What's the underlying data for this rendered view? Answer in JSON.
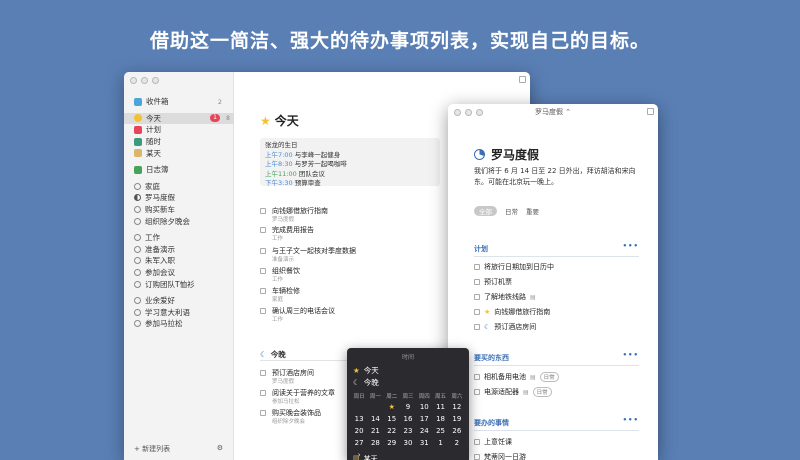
{
  "headline": "借助这一简洁、强大的待办事项列表，实现自己的目标。",
  "sidebar": {
    "items": [
      {
        "label": "收件箱",
        "count": "2",
        "color": "#4aa6d8"
      },
      {
        "label": "今天",
        "badge": "1",
        "count": "8",
        "color": "#f3c233"
      },
      {
        "label": "计划",
        "color": "#e8455a"
      },
      {
        "label": "随时",
        "color": "#3b9b7a"
      },
      {
        "label": "某天",
        "color": "#d9b668"
      },
      {
        "label": "日志簿",
        "color": "#45a35a"
      }
    ],
    "areas": [
      {
        "title": "家庭",
        "projects": [
          "罗马度假",
          "购买新车",
          "组织除夕晚会"
        ]
      },
      {
        "title": "工作",
        "projects": [
          "准备演示",
          "朱军入职",
          "参加会议",
          "订购团队T恤衫"
        ]
      },
      {
        "title": "业余爱好",
        "projects": [
          "学习意大利语",
          "参加马拉松"
        ]
      }
    ],
    "new_list": "+ 新建列表",
    "settings_icon": "sliders-icon"
  },
  "today": {
    "title": "今天",
    "calendar": [
      {
        "time": "",
        "text": "张龙的生日"
      },
      {
        "time": "上午7:00",
        "text": "与李峰一起健身"
      },
      {
        "time": "上午8:30",
        "text": "与罗芳一起喝咖啡"
      },
      {
        "time": "上午11:00",
        "text": "团队会议"
      },
      {
        "time": "下午3:30",
        "text": "预算审查"
      }
    ],
    "tasks": [
      {
        "title": "向钱娜借旅行指南",
        "sub": "罗马度假"
      },
      {
        "title": "完成费用报告",
        "sub": "工作"
      },
      {
        "title": "与王子文一起核对季度数据",
        "sub": "准备演示"
      },
      {
        "title": "组织餐饮",
        "sub": "工作"
      },
      {
        "title": "车辆检修",
        "sub": "家庭"
      },
      {
        "title": "确认周三的电话会议",
        "sub": "工作"
      }
    ],
    "evening_label": "今晚",
    "evening_tasks": [
      {
        "title": "预订酒店房间",
        "sub": "罗马度假"
      },
      {
        "title": "阅读关于营养的文章",
        "sub": "参加马拉松"
      },
      {
        "title": "购买晚会装饰品",
        "sub": "组织除夕晚会"
      }
    ]
  },
  "project": {
    "window_title": "罗马度假 ⌃",
    "title": "罗马度假",
    "notes": "我们将于 6 月 14 日至 22 日外出，拜访胡洁和宋向东。可能在北京玩一晚上。",
    "tags": [
      "全部",
      "日常",
      "重要"
    ],
    "sections": [
      {
        "title": "计划",
        "tasks": [
          {
            "title": "将旅行日期加到日历中"
          },
          {
            "title": "预订机票"
          },
          {
            "title": "了解地铁线路",
            "note": true
          },
          {
            "title": "向钱娜借旅行指南",
            "star": true
          },
          {
            "title": "预订酒店房间",
            "moon": true
          }
        ]
      },
      {
        "title": "要买的东西",
        "tasks": [
          {
            "title": "相机备用电池",
            "note": true,
            "tag": "日常"
          },
          {
            "title": "电源适配器",
            "note": true,
            "tag": "日常"
          }
        ]
      },
      {
        "title": "要办的事情",
        "tasks": [
          {
            "title": "上意饪课"
          },
          {
            "title": "梵蒂冈一日游"
          }
        ]
      }
    ],
    "more": "•••"
  },
  "popover": {
    "search_placeholder": "时间",
    "today": "今天",
    "tonight": "今晚",
    "weekdays": [
      "周日",
      "周一",
      "周二",
      "周三",
      "周四",
      "周五",
      "周六"
    ],
    "days": [
      "",
      "",
      "★",
      "9",
      "10",
      "11",
      "12",
      "13",
      "14",
      "15",
      "16",
      "17",
      "18",
      "19",
      "20",
      "21",
      "22",
      "23",
      "24",
      "25",
      "26",
      "27",
      "28",
      "29",
      "30",
      "31",
      "1",
      "2",
      "›"
    ],
    "someday": "某天"
  }
}
